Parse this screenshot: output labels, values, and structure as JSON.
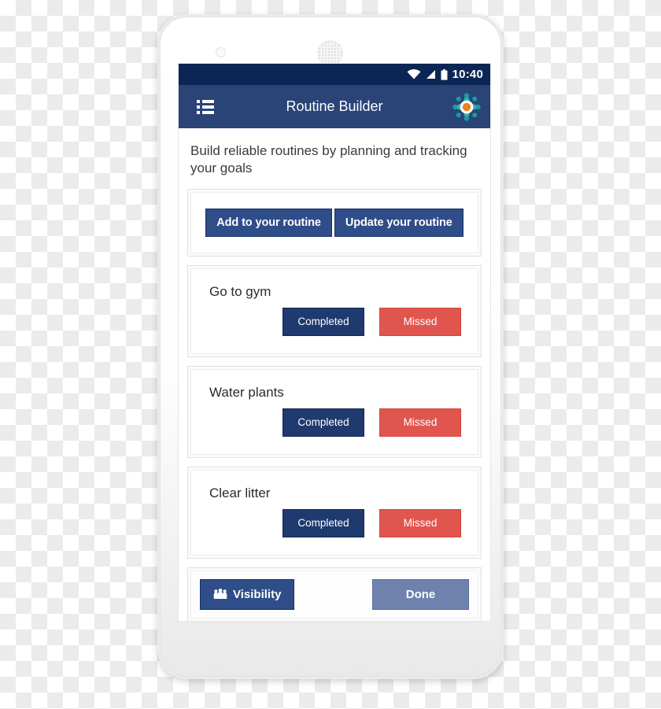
{
  "device": {
    "camera_icon": "camera-icon",
    "speaker_icon": "speaker-grille-icon"
  },
  "status_bar": {
    "time": "10:40",
    "icons": [
      "wifi-icon",
      "cellular-signal-icon",
      "battery-icon"
    ]
  },
  "app_bar": {
    "menu_icon": "list-menu-icon",
    "title": "Routine Builder",
    "settings_icon": "gear-settings-icon"
  },
  "intro": {
    "text": "Build reliable routines by planning and tracking your goals"
  },
  "actions": {
    "add_label": "Add to your routine",
    "update_label": "Update your routine"
  },
  "tasks": [
    {
      "title": "Go to gym",
      "completed_label": "Completed",
      "missed_label": "Missed"
    },
    {
      "title": "Water plants",
      "completed_label": "Completed",
      "missed_label": "Missed"
    },
    {
      "title": "Clear litter",
      "completed_label": "Completed",
      "missed_label": "Missed"
    }
  ],
  "footer": {
    "visibility_label": "Visibility",
    "visibility_icon": "people-group-icon",
    "done_label": "Done"
  },
  "colors": {
    "status_bar": "#0b2654",
    "app_bar": "#2a4478",
    "primary_button": "#2f4d89",
    "completed_button": "#1f3a6e",
    "missed_button": "#e0564f",
    "done_button": "#6e82ad",
    "settings_accent": "#f07d1f",
    "settings_teal": "#1d9a9e"
  }
}
